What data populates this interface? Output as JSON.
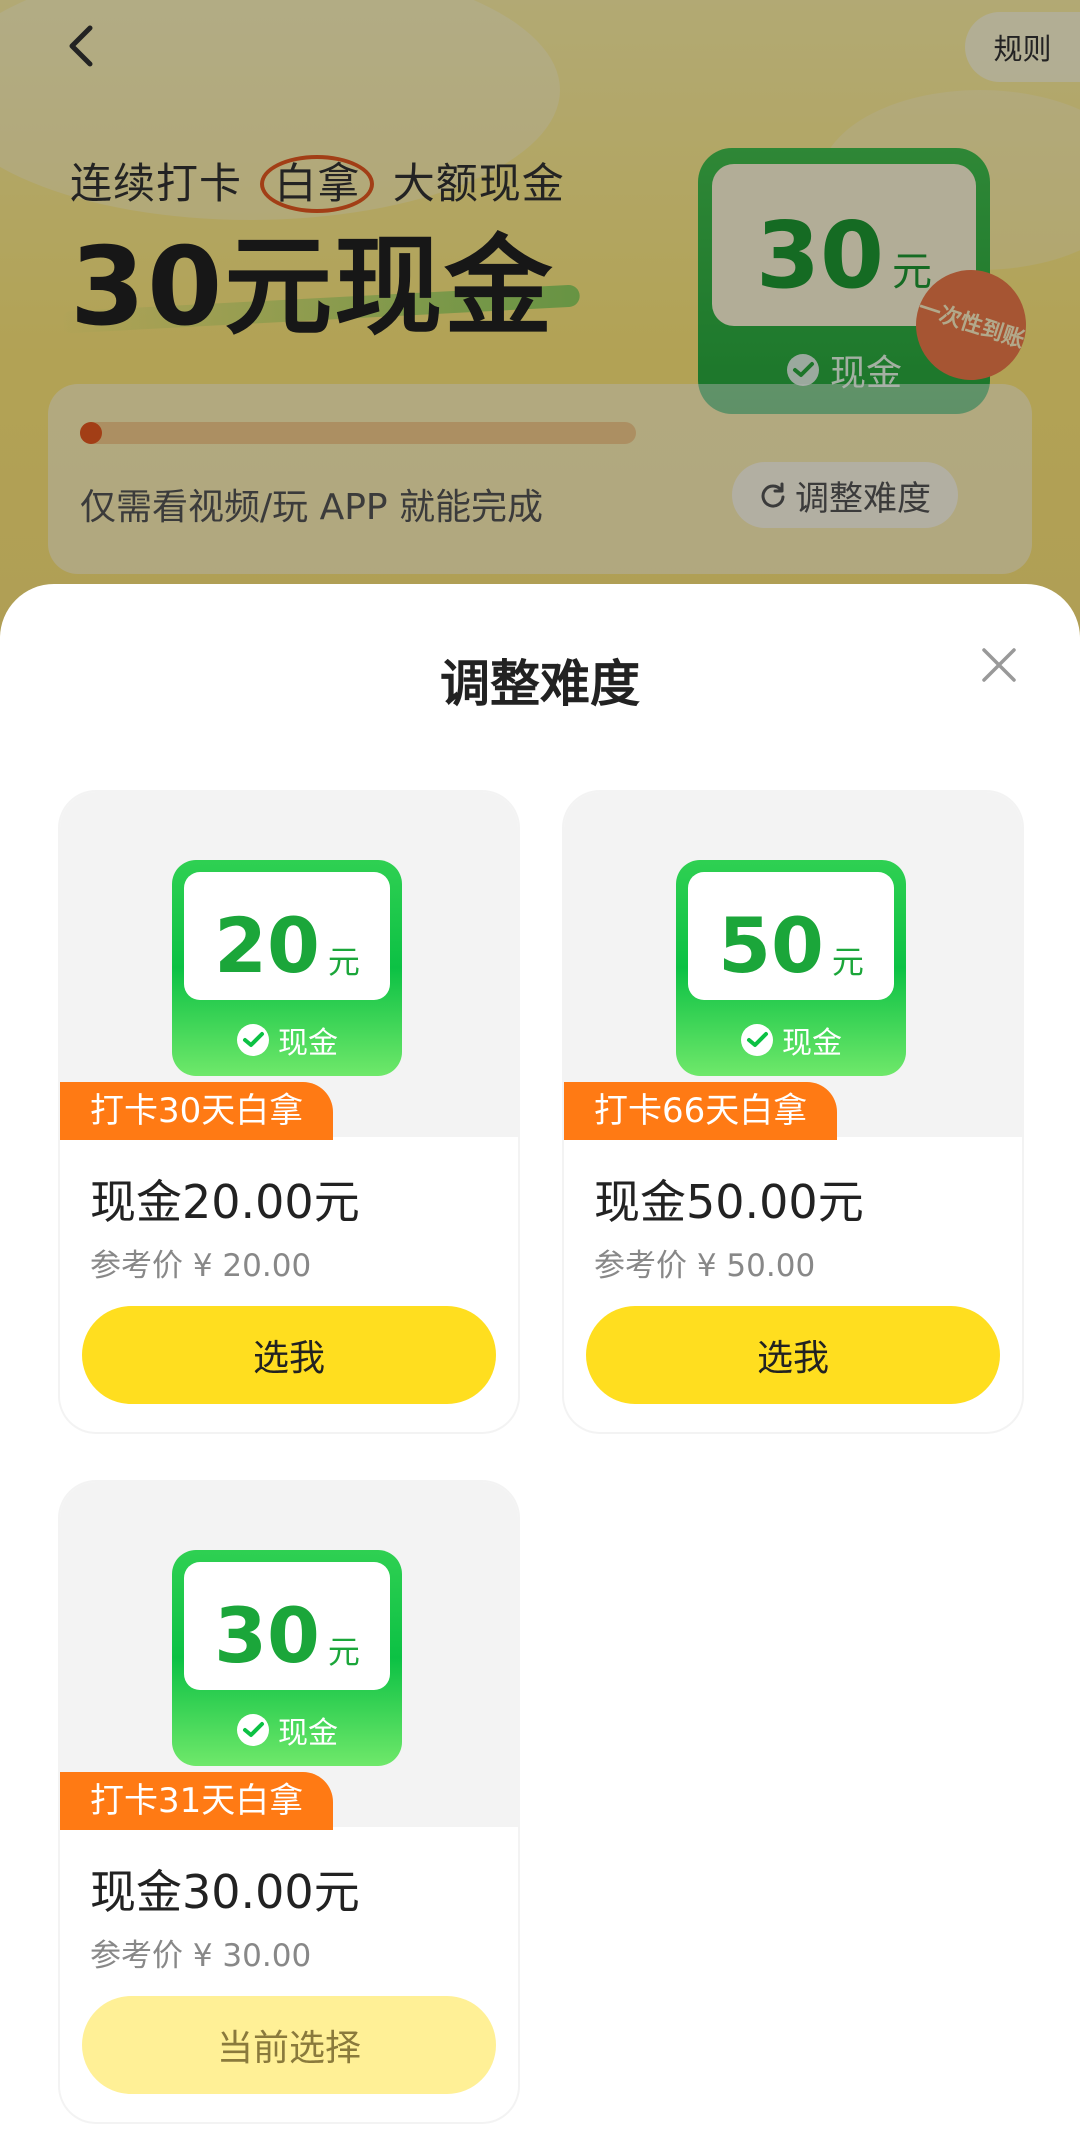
{
  "header": {
    "rules_label": "规则"
  },
  "hero": {
    "subtitle_before": "连续打卡",
    "subtitle_circled": "白拿",
    "subtitle_after": "大额现金",
    "title": "30元现金",
    "card_amount": "30",
    "card_unit": "元",
    "card_footer": "现金",
    "badge": "一次性到账",
    "progress": 0.02,
    "description": "仅需看视频/玩 APP 就能完成",
    "adjust_label": "调整难度"
  },
  "sheet": {
    "title": "调整难度",
    "options": [
      {
        "amount": "20",
        "unit": "元",
        "footer": "现金",
        "tag": "打卡30天白拿",
        "price_title": "现金20.00元",
        "ref_price": "参考价 ¥ 20.00",
        "button": "选我",
        "current": false
      },
      {
        "amount": "50",
        "unit": "元",
        "footer": "现金",
        "tag": "打卡66天白拿",
        "price_title": "现金50.00元",
        "ref_price": "参考价 ¥ 50.00",
        "button": "选我",
        "current": false
      },
      {
        "amount": "30",
        "unit": "元",
        "footer": "现金",
        "tag": "打卡31天白拿",
        "price_title": "现金30.00元",
        "ref_price": "参考价 ¥ 30.00",
        "button": "当前选择",
        "current": true
      }
    ]
  },
  "colors": {
    "primary_button": "#ffde1f",
    "current_button": "#fff096",
    "tag_orange": "#ff7a14",
    "cash_green": "#0cc144"
  },
  "icons": {
    "back": "chevron-left-icon",
    "close": "close-icon",
    "wechat": "wechat-pay-icon",
    "refresh": "refresh-icon"
  }
}
